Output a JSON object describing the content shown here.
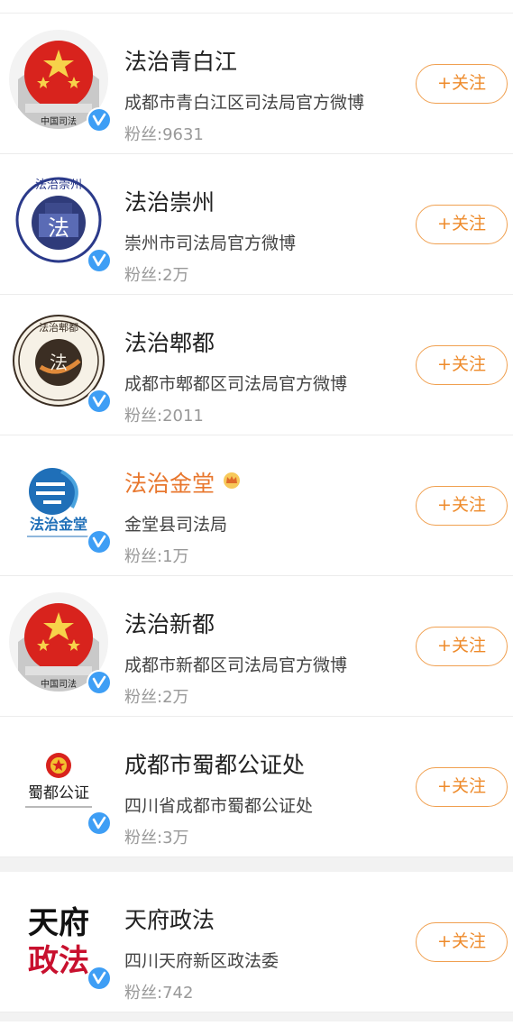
{
  "accounts": [
    {
      "name": "法治青白江",
      "desc": "成都市青白江区司法局官方微博",
      "fans": "粉丝:9631",
      "follow": "+关注",
      "verified": true,
      "avatar_icon": "national-emblem-icon",
      "avatar_text": "中国司法"
    },
    {
      "name": "法治崇州",
      "desc": "崇州市司法局官方微博",
      "fans": "粉丝:2万",
      "follow": "+关注",
      "verified": true,
      "avatar_icon": "chongzhou-law-icon",
      "avatar_text": "法治崇州"
    },
    {
      "name": "法治郫都",
      "desc": "成都市郫都区司法局官方微博",
      "fans": "粉丝:2011",
      "follow": "+关注",
      "verified": true,
      "avatar_icon": "pidu-law-icon",
      "avatar_text": "法治郫都"
    },
    {
      "name": "法治金堂",
      "desc": "金堂县司法局",
      "fans": "粉丝:1万",
      "follow": "+关注",
      "verified": true,
      "vip": true,
      "avatar_icon": "jintang-law-icon",
      "avatar_text": "法治金堂"
    },
    {
      "name": "法治新都",
      "desc": "成都市新都区司法局官方微博",
      "fans": "粉丝:2万",
      "follow": "+关注",
      "verified": true,
      "avatar_icon": "national-emblem-icon",
      "avatar_text": "中国司法"
    },
    {
      "name": "成都市蜀都公证处",
      "desc": "四川省成都市蜀都公证处",
      "fans": "粉丝:3万",
      "follow": "+关注",
      "verified": true,
      "avatar_icon": "notary-emblem-icon",
      "avatar_text": "蜀都公证"
    },
    {
      "name": "天府政法",
      "desc": "四川天府新区政法委",
      "fans": "粉丝:742",
      "follow": "+关注",
      "verified": true,
      "avatar_icon": "tianfu-logo-icon",
      "avatar_text": "天府政法"
    }
  ],
  "colors": {
    "accent": "#ee8a2a",
    "verified": "#3e9ef5",
    "vip_name": "#e8772e"
  }
}
